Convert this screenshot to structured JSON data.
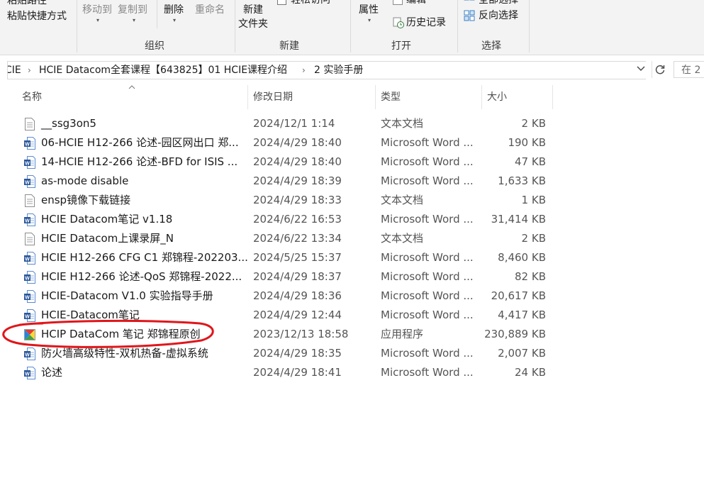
{
  "ribbon": {
    "top_paste_text": "粘贴路径",
    "paste_shortcut": "粘贴快捷方式",
    "move_to": "移动到",
    "copy_to": "复制到",
    "delete": "删除",
    "rename": "重命名",
    "new_folder_line1": "新建",
    "new_folder_line2": "文件夹",
    "easy_access": "轻松访问",
    "properties": "属性",
    "edit": "编辑",
    "history": "历史记录",
    "select_all": "全部选择",
    "invert_selection": "反向选择",
    "groups": {
      "organize": "组织",
      "new": "新建",
      "open": "打开",
      "select": "选择"
    }
  },
  "address": {
    "crumbs": [
      "CIE",
      "HCIE Datacom全套课程【643825】01 HCIE课程介绍",
      "2 实验手册"
    ],
    "search_placeholder": "在 2"
  },
  "columns": {
    "name": "名称",
    "date": "修改日期",
    "type": "类型",
    "size": "大小"
  },
  "files": [
    {
      "name": "__ssg3on5",
      "date": "2024/12/1 1:14",
      "type": "文本文档",
      "size": "2 KB",
      "icon": "text-file-icon"
    },
    {
      "name": "06-HCIE H12-266 论述-园区网出口  郑...",
      "date": "2024/4/29 18:40",
      "type": "Microsoft Word ...",
      "size": "190 KB",
      "icon": "word-file-icon"
    },
    {
      "name": "14-HCIE H12-266 论述-BFD for ISIS  ...",
      "date": "2024/4/29 18:40",
      "type": "Microsoft Word ...",
      "size": "47 KB",
      "icon": "word-file-icon"
    },
    {
      "name": "as-mode disable",
      "date": "2024/4/29 18:39",
      "type": "Microsoft Word ...",
      "size": "1,633 KB",
      "icon": "word-file-icon"
    },
    {
      "name": "ensp镜像下载链接",
      "date": "2024/4/29 18:33",
      "type": "文本文档",
      "size": "1 KB",
      "icon": "text-file-icon"
    },
    {
      "name": "HCIE Datacom笔记 v1.18",
      "date": "2024/6/22 16:53",
      "type": "Microsoft Word ...",
      "size": "31,414 KB",
      "icon": "word-file-icon"
    },
    {
      "name": "HCIE Datacom上课录屏_N",
      "date": "2024/6/22 13:34",
      "type": "文本文档",
      "size": "2 KB",
      "icon": "text-file-icon"
    },
    {
      "name": "HCIE H12-266 CFG C1 郑锦程-202203...",
      "date": "2024/5/25 15:37",
      "type": "Microsoft Word ...",
      "size": "8,460 KB",
      "icon": "word-file-icon"
    },
    {
      "name": "HCIE H12-266 论述-QoS  郑锦程-2022...",
      "date": "2024/4/29 18:37",
      "type": "Microsoft Word ...",
      "size": "82 KB",
      "icon": "word-file-icon"
    },
    {
      "name": "HCIE-Datacom V1.0 实验指导手册",
      "date": "2024/4/29 18:36",
      "type": "Microsoft Word ...",
      "size": "20,617 KB",
      "icon": "word-file-icon"
    },
    {
      "name": "HCIE-Datacom笔记",
      "date": "2024/4/29 12:44",
      "type": "Microsoft Word ...",
      "size": "4,417 KB",
      "icon": "word-file-icon"
    },
    {
      "name": "HCIP DataCom 笔记  郑锦程原创",
      "date": "2023/12/13 18:58",
      "type": "应用程序",
      "size": "230,889 KB",
      "icon": "application-icon"
    },
    {
      "name": "防火墙高级特性-双机热备-虚拟系统",
      "date": "2024/4/29 18:35",
      "type": "Microsoft Word ...",
      "size": "2,007 KB",
      "icon": "word-file-icon"
    },
    {
      "name": "论述",
      "date": "2024/4/29 18:41",
      "type": "Microsoft Word ...",
      "size": "24 KB",
      "icon": "word-file-icon"
    }
  ],
  "colors": {
    "annotation": "#e0161b",
    "word_blue": "#2b579a",
    "ribbon_bg": "#f3f3f3"
  }
}
